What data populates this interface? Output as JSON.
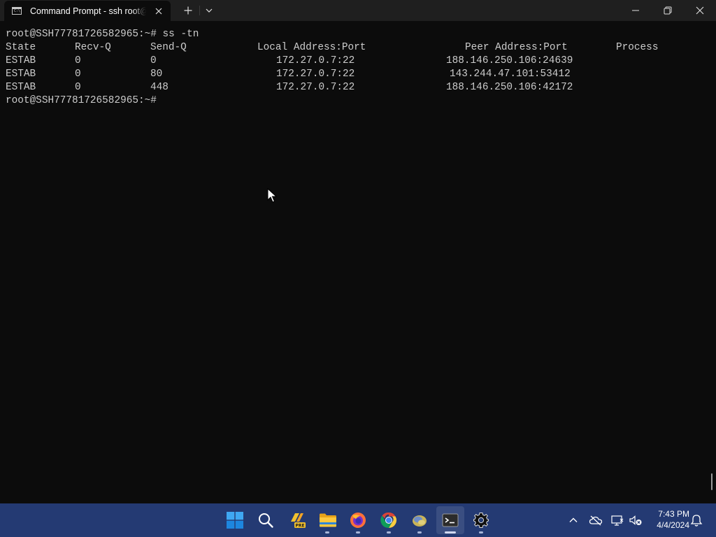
{
  "window": {
    "tab_title": "Command Prompt - ssh  root@",
    "app_icon_text": "C:\\."
  },
  "terminal": {
    "prompt_line_1": "root@SSH77781726582965:~# ss -tn",
    "headers": [
      "State",
      "Recv-Q",
      "Send-Q",
      "Local Address:Port",
      "Peer Address:Port",
      "Process"
    ],
    "rows": [
      {
        "state": "ESTAB",
        "recv_q": "0",
        "send_q": "0",
        "local": "172.27.0.7:22",
        "peer": "188.146.250.106:24639",
        "process": ""
      },
      {
        "state": "ESTAB",
        "recv_q": "0",
        "send_q": "80",
        "local": "172.27.0.7:22",
        "peer": "143.244.47.101:53412",
        "process": ""
      },
      {
        "state": "ESTAB",
        "recv_q": "0",
        "send_q": "448",
        "local": "172.27.0.7:22",
        "peer": "188.146.250.106:42172",
        "process": ""
      }
    ],
    "prompt_line_2": "root@SSH77781726582965:~#"
  },
  "taskbar": {
    "apps": [
      {
        "name": "start",
        "icon": "windows-logo-icon"
      },
      {
        "name": "search",
        "icon": "search-icon"
      },
      {
        "name": "note-app-pre",
        "icon": "sticky-notes-pre-icon",
        "badge": "PRE"
      },
      {
        "name": "file-explorer",
        "icon": "folder-icon"
      },
      {
        "name": "firefox",
        "icon": "firefox-icon"
      },
      {
        "name": "chrome",
        "icon": "chrome-icon"
      },
      {
        "name": "python-tool",
        "icon": "app-icon"
      },
      {
        "name": "terminal",
        "icon": "terminal-icon"
      },
      {
        "name": "settings",
        "icon": "gear-icon"
      }
    ],
    "clock": {
      "time": "7:43 PM",
      "date": "4/4/2024"
    }
  },
  "colors": {
    "titlebar": "#1f1f1f",
    "terminal_bg": "#0c0c0c",
    "terminal_fg": "#cccccc",
    "taskbar": "#243a73"
  }
}
